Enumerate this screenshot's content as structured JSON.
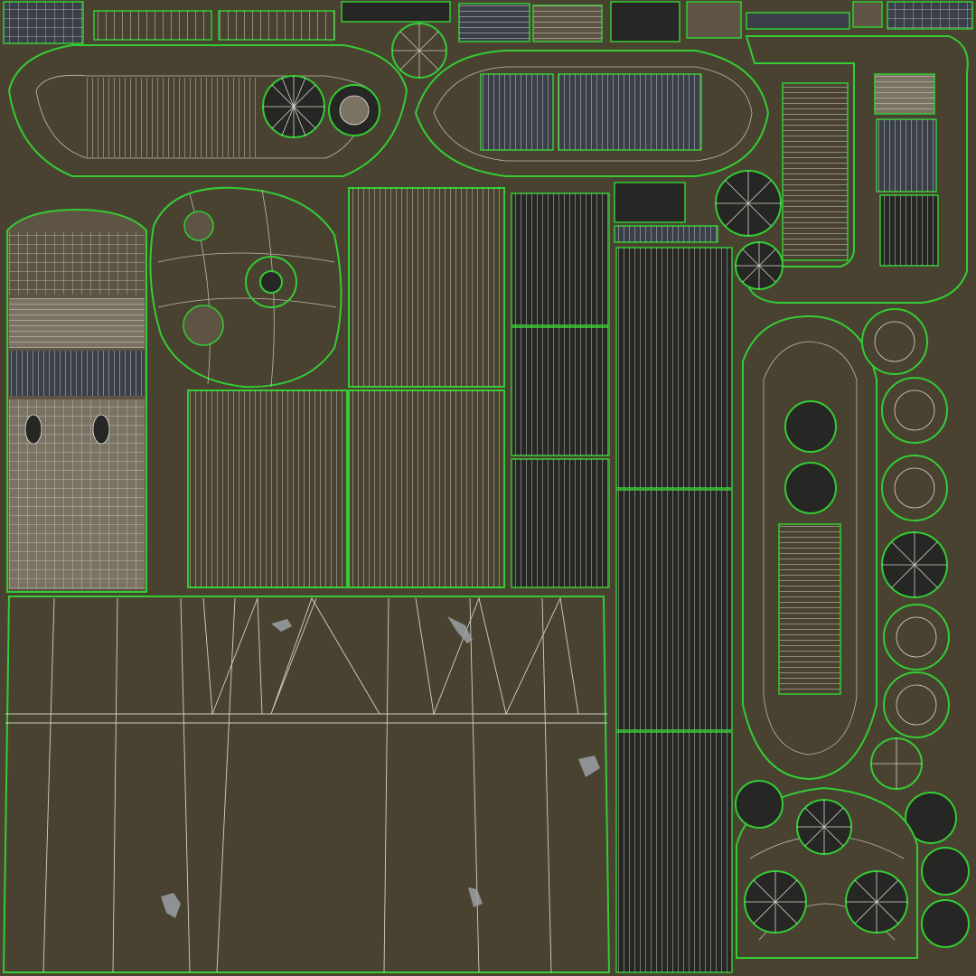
{
  "colors": {
    "background": "#4a4231",
    "panel_fill": "#4a4231",
    "panel_fill_light": "#5e5443",
    "panel_fill_pale": "#7a7262",
    "panel_fill_dark": "#262624",
    "panel_fill_navy": "#3b3f4a",
    "seam_green": "#33cc33",
    "wire_white": "#e8e8e0",
    "scuff": "#9aa0a4"
  },
  "islands": [
    {
      "name": "uv-island-fuel-tank-side",
      "tone": "dark",
      "grid": "vertical"
    },
    {
      "name": "uv-island-fuel-tank-top",
      "tone": "dark",
      "grid": "vertical"
    },
    {
      "name": "uv-island-nacelle-bottom",
      "tone": "dark",
      "grid": "vertical"
    },
    {
      "name": "uv-island-hull-side",
      "tone": "base",
      "grid": "fan"
    },
    {
      "name": "uv-island-hull-plate-a",
      "tone": "base",
      "grid": "vertical"
    },
    {
      "name": "uv-island-hull-plate-b",
      "tone": "base",
      "grid": "vertical"
    },
    {
      "name": "uv-island-hull-plate-c",
      "tone": "base",
      "grid": "vertical"
    },
    {
      "name": "uv-island-turret-left",
      "tone": "light",
      "grid": "mixed"
    },
    {
      "name": "uv-island-blister",
      "tone": "base",
      "grid": "radial"
    },
    {
      "name": "uv-island-float-left",
      "tone": "base",
      "grid": "ring"
    },
    {
      "name": "uv-island-float-right",
      "tone": "base",
      "grid": "ring"
    },
    {
      "name": "uv-island-tail-ring",
      "tone": "base",
      "grid": "ring"
    },
    {
      "name": "uv-island-tail-plate",
      "tone": "base",
      "grid": "vertical"
    },
    {
      "name": "uv-island-engine-cluster",
      "tone": "base",
      "grid": "radial"
    }
  ]
}
